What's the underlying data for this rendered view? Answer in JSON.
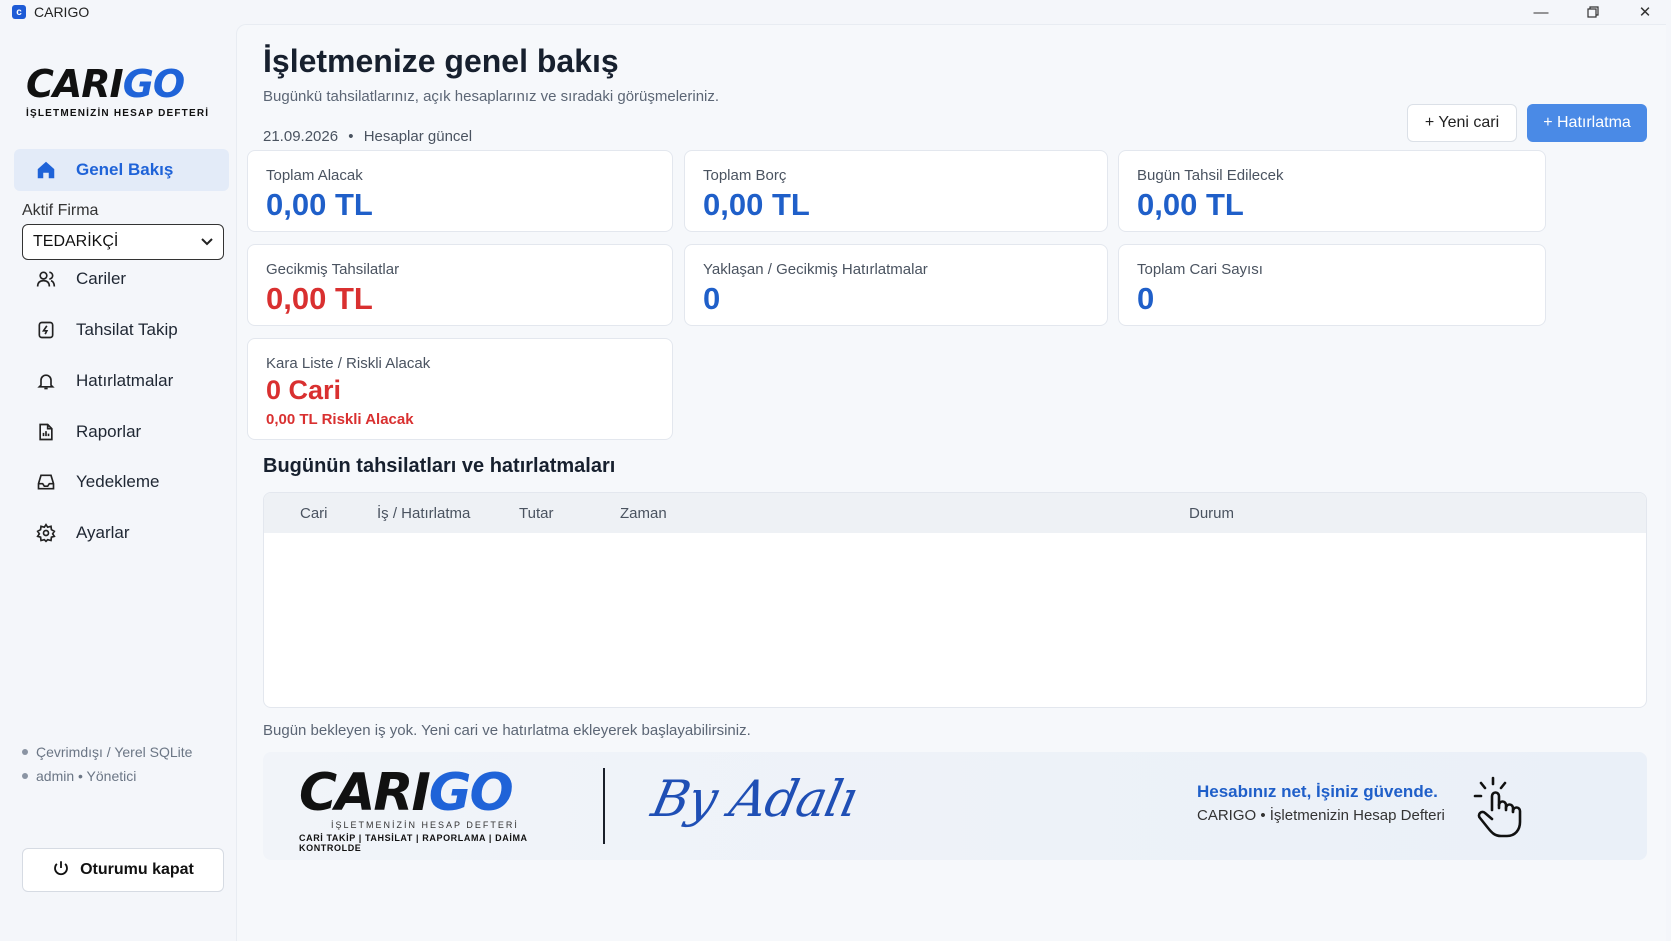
{
  "window": {
    "title": "CARIGO"
  },
  "sidebar": {
    "logo": {
      "main": "CARI",
      "accent": "GO",
      "subtitle": "İŞLETMENİZİN HESAP DEFTERİ"
    },
    "active_item": {
      "label": "Genel Bakış",
      "icon": "home-icon"
    },
    "firm_label": "Aktif Firma",
    "firm_value": "TEDARİKÇİ",
    "items": [
      {
        "label": "Cariler",
        "icon": "users-icon"
      },
      {
        "label": "Tahsilat Takip",
        "icon": "payment-icon"
      },
      {
        "label": "Hatırlatmalar",
        "icon": "bell-icon"
      },
      {
        "label": "Raporlar",
        "icon": "report-icon"
      },
      {
        "label": "Yedekleme",
        "icon": "backup-icon"
      },
      {
        "label": "Ayarlar",
        "icon": "gear-icon"
      }
    ],
    "status_connection": "Çevrimdışı / Yerel SQLite",
    "status_user": "admin • Yönetici",
    "logout_label": "Oturumu kapat"
  },
  "header": {
    "title": "İşletmenize genel bakış",
    "subtitle": "Bugünkü tahsilatlarınız, açık hesaplarınız ve sıradaki görüşmeleriniz.",
    "date": "21.09.2026",
    "separator": "•",
    "date_status": "Hesaplar güncel",
    "new_account_label": "+ Yeni cari",
    "reminder_label": "+ Hatırlatma"
  },
  "cards": [
    {
      "label": "Toplam Alacak",
      "value": "0,00 TL",
      "color": "#1f5fc9"
    },
    {
      "label": "Toplam Borç",
      "value": "0,00 TL",
      "color": "#1f5fc9"
    },
    {
      "label": "Bugün Tahsil Edilecek",
      "value": "0,00 TL",
      "color": "#1f5fc9"
    },
    {
      "label": "Gecikmiş Tahsilatlar",
      "value": "0,00 TL",
      "color": "#d93030"
    },
    {
      "label": "Yaklaşan / Gecikmiş Hatırlatmalar",
      "value": "0",
      "color": "#1f5fc9"
    },
    {
      "label": "Toplam Cari Sayısı",
      "value": "0",
      "color": "#1f5fc9"
    },
    {
      "label": "Kara Liste / Riskli Alacak",
      "value": "0 Cari",
      "sub": "0,00 TL Riskli Alacak",
      "color": "#d93030"
    }
  ],
  "today": {
    "title": "Bugünün tahsilatları ve hatırlatmaları",
    "columns": [
      "Cari",
      "İş / Hatırlatma",
      "Tutar",
      "Zaman",
      "Durum"
    ],
    "rows": [],
    "empty_note": "Bugün bekleyen iş yok. Yeni cari ve hatırlatma ekleyerek başlayabilirsiniz."
  },
  "banner": {
    "logo_main": "CARI",
    "logo_accent": "GO",
    "logo_tagline": "İŞLETMENİZİN HESAP DEFTERİ",
    "logo_features": "CARİ TAKİP | TAHSİLAT | RAPORLAMA | DAİMA KONTROLDE",
    "signature": "By Adalı",
    "slogan": "Hesabınız net, İşiniz güvende.",
    "brand_line": "CARIGO • İşletmenizin Hesap Defteri"
  },
  "colors": {
    "accent": "#1f63d8",
    "danger": "#d93030",
    "button_primary": "#4a8ae6"
  }
}
